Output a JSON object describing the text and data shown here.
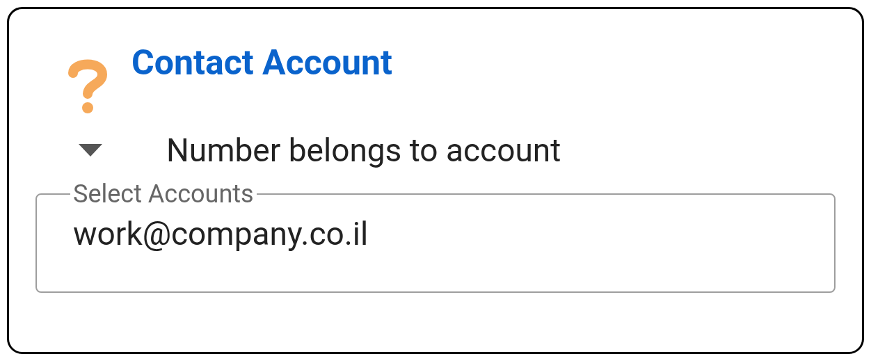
{
  "title": "Contact Account",
  "dropdown": {
    "label": "Number belongs to account"
  },
  "field": {
    "label": "Select Accounts",
    "value": "work@company.co.il"
  }
}
